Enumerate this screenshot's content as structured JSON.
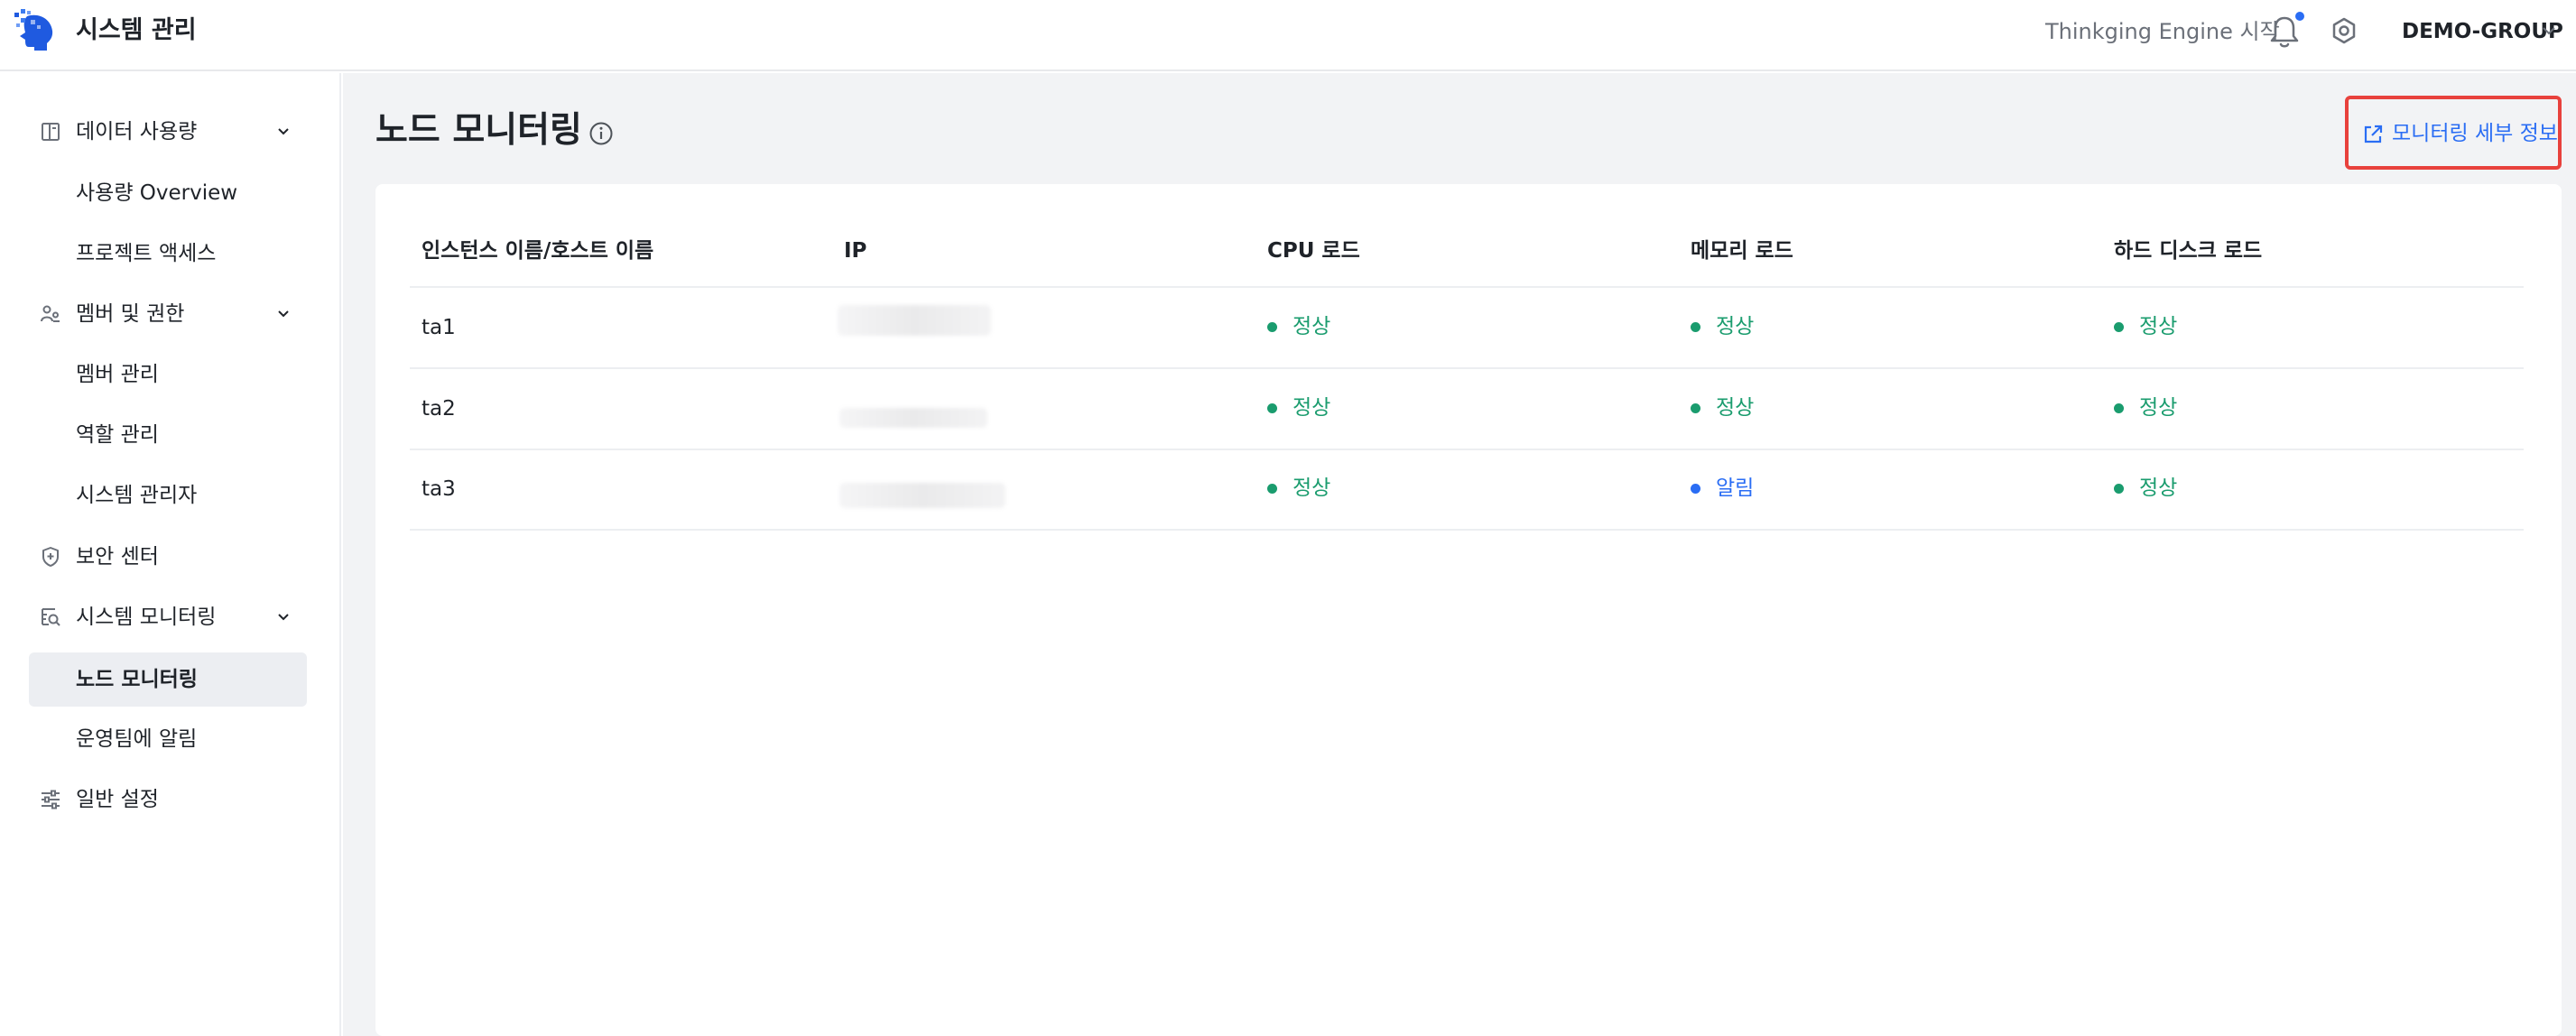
{
  "header": {
    "app_title": "시스템 관리",
    "start_link": "Thinkging Engine 시작",
    "group_name": "DEMO-GROUP",
    "notification_dot_color": "#2a6df4"
  },
  "sidebar": {
    "groups": [
      {
        "label": "데이터 사용량",
        "icon": "book-icon"
      },
      {
        "label": "멤버 및 권한",
        "icon": "users-icon"
      },
      {
        "label": "보안 센터",
        "icon": "shield-icon"
      },
      {
        "label": "시스템 모니터링",
        "icon": "monitor-search-icon"
      },
      {
        "label": "일반 설정",
        "icon": "sliders-icon"
      }
    ],
    "items": [
      {
        "label": "사용량 Overview"
      },
      {
        "label": "프로젝트 액세스"
      },
      {
        "label": "멤버 관리"
      },
      {
        "label": "역할 관리"
      },
      {
        "label": "시스템 관리자"
      },
      {
        "label": "노드 모니터링"
      },
      {
        "label": "운영팀에 알림"
      }
    ],
    "active_item": "노드 모니터링"
  },
  "main": {
    "page_title": "노드 모니터링",
    "detail_link": "모니터링 세부 정보",
    "table": {
      "columns": [
        "인스턴스 이름/호스트 이름",
        "IP",
        "CPU 로드",
        "메모리 로드",
        "하드 디스크 로드"
      ],
      "rows": [
        {
          "name": "ta1",
          "cpu": "정상",
          "memory": "정상",
          "disk": "정상"
        },
        {
          "name": "ta2",
          "cpu": "정상",
          "memory": "정상",
          "disk": "정상"
        },
        {
          "name": "ta3",
          "cpu": "정상",
          "memory": "알림",
          "disk": "정상"
        }
      ]
    }
  },
  "colors": {
    "accent": "#2a6df4",
    "status_normal": "#1a9c6e",
    "status_alert": "#2a6df4",
    "highlight_border": "#e8413c"
  }
}
